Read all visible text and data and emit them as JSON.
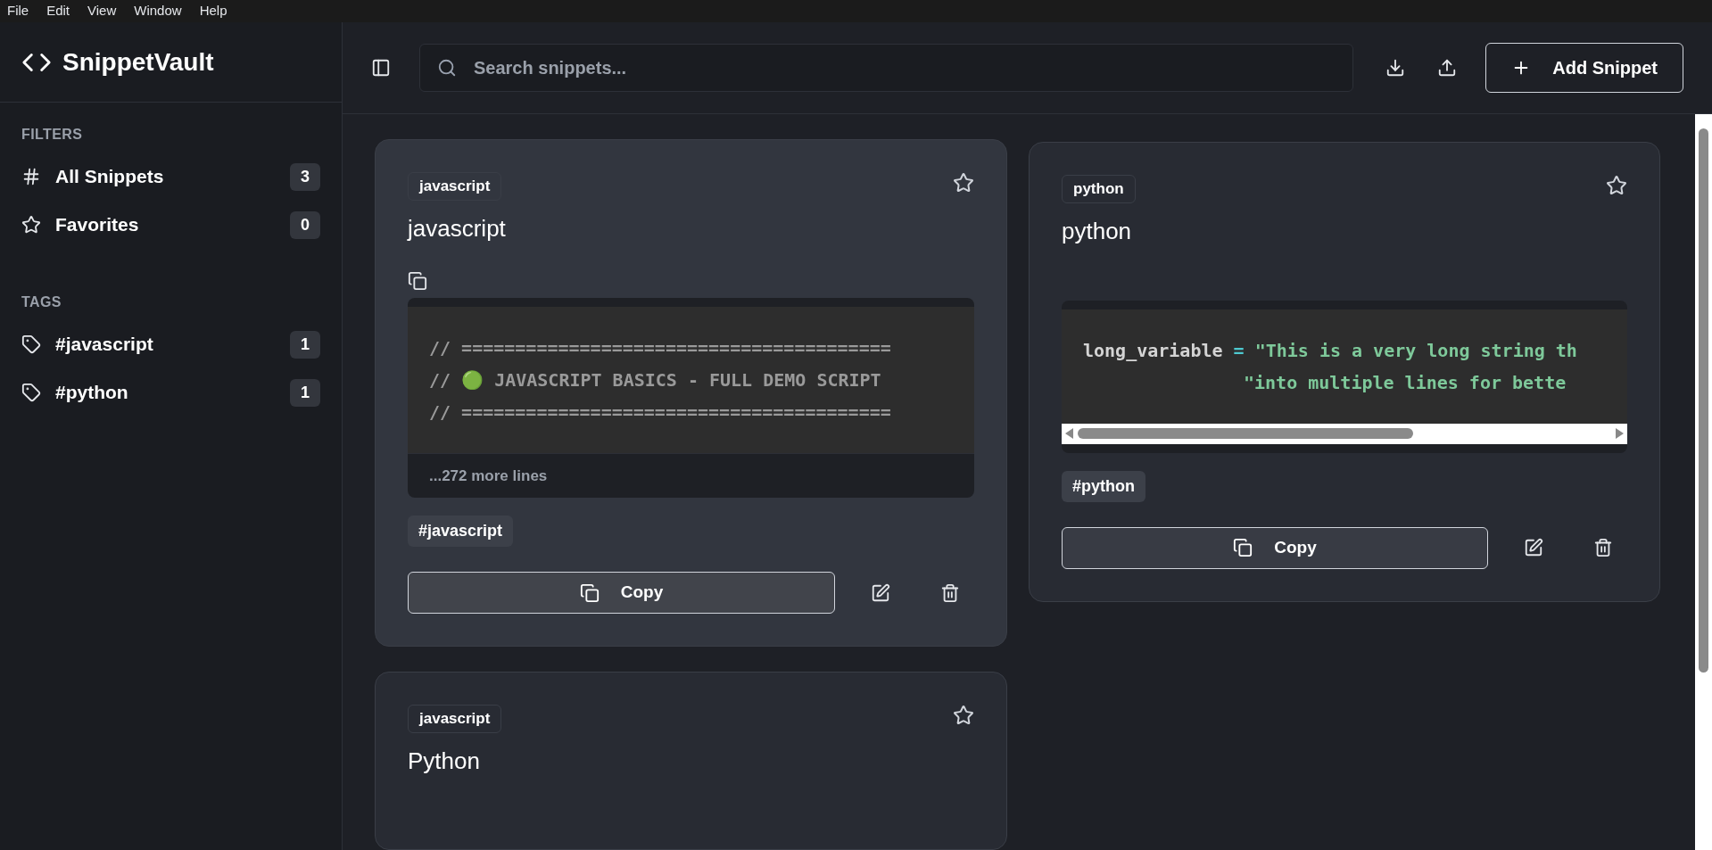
{
  "menu": [
    "File",
    "Edit",
    "View",
    "Window",
    "Help"
  ],
  "sidebar": {
    "app_name": "SnippetVault",
    "sections": [
      {
        "heading": "FILTERS",
        "items": [
          {
            "kind": "all",
            "label": "All Snippets",
            "count": "3",
            "selected": false
          },
          {
            "kind": "favorites",
            "label": "Favorites",
            "count": "0",
            "selected": false
          }
        ]
      },
      {
        "heading": "TAGS",
        "items": [
          {
            "kind": "tag",
            "label": "#javascript",
            "count": "1",
            "selected": false
          },
          {
            "kind": "tag",
            "label": "#python",
            "count": "1",
            "selected": false
          }
        ]
      }
    ]
  },
  "header": {
    "search": {
      "placeholder": "Search snippets..."
    },
    "add_button": "Add Snippet"
  },
  "snippets": [
    {
      "language": "javascript",
      "title": "javascript",
      "favorite": false,
      "hovered": true,
      "scrollable": false,
      "code": [
        {
          "continuation": false,
          "segments": [
            {
              "kind": "comment",
              "text": "// ========================================"
            }
          ]
        },
        {
          "continuation": false,
          "segments": [
            {
              "kind": "comment",
              "text": "// 🟢 JAVASCRIPT BASICS - FULL DEMO SCRIPT"
            }
          ]
        },
        {
          "continuation": false,
          "segments": [
            {
              "kind": "comment",
              "text": "// ========================================"
            }
          ]
        }
      ],
      "more_lines": "...272 more lines",
      "tags": [
        "#javascript"
      ],
      "copy_label": "Copy"
    },
    {
      "language": "python",
      "title": "python",
      "favorite": false,
      "hovered": false,
      "scrollable": true,
      "code": [
        {
          "continuation": false,
          "segments": [
            {
              "kind": "plain",
              "text": "long_variable "
            },
            {
              "kind": "operator",
              "text": "="
            },
            {
              "kind": "string",
              "text": " \"This is a very long string th"
            }
          ]
        },
        {
          "continuation": true,
          "segments": [
            {
              "kind": "string",
              "text": "\"into multiple lines for bette"
            }
          ]
        }
      ],
      "tags": [
        "#python"
      ],
      "copy_label": "Copy"
    },
    {
      "language": "javascript",
      "title": "Python",
      "favorite": false,
      "hovered": false
    }
  ]
}
